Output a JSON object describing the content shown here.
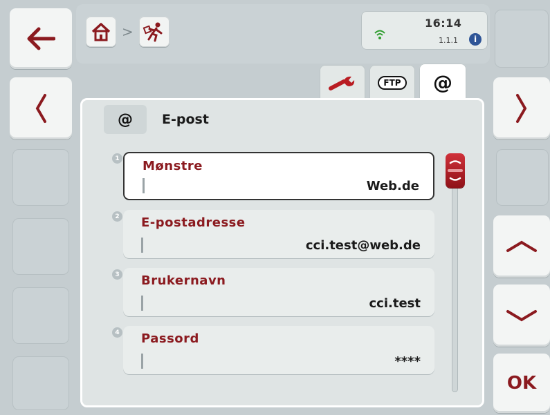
{
  "colors": {
    "accent_red": "#8b1a1f",
    "scroll_thumb": "#c0202a",
    "wifi_green": "#2e9d2e",
    "info_blue": "#2f5597"
  },
  "left_softkeys": [
    {
      "icon": "arrow-left-icon",
      "label": ""
    },
    {
      "icon": "chevron-left-icon",
      "label": ""
    },
    {
      "icon": "",
      "label": ""
    },
    {
      "icon": "",
      "label": ""
    },
    {
      "icon": "",
      "label": ""
    },
    {
      "icon": "",
      "label": ""
    }
  ],
  "right_softkeys": [
    {
      "icon": "",
      "label": ""
    },
    {
      "icon": "chevron-right-icon",
      "label": ""
    },
    {
      "icon": "",
      "label": ""
    },
    {
      "icon": "chevron-up-icon",
      "label": ""
    },
    {
      "icon": "chevron-down-icon",
      "label": ""
    },
    {
      "icon": "",
      "label": "OK"
    }
  ],
  "breadcrumb": {
    "separator": ">",
    "items": [
      {
        "icon": "home-icon"
      },
      {
        "icon": "service-person-icon"
      }
    ]
  },
  "status": {
    "time": "16:14",
    "version": "1.1.1",
    "info": "i"
  },
  "tabs": [
    {
      "icon": "wrench-icon",
      "label": ""
    },
    {
      "icon": "ftp-icon",
      "label": "FTP"
    },
    {
      "icon": "at-icon",
      "label": "@",
      "active": true
    }
  ],
  "panel": {
    "title_icon": "@",
    "title": "E-post"
  },
  "fields": [
    {
      "index": "1",
      "label": "Mønstre",
      "value": "Web.de",
      "selected": true
    },
    {
      "index": "2",
      "label": "E-postadresse",
      "value": "cci.test@web.de",
      "selected": false
    },
    {
      "index": "3",
      "label": "Brukernavn",
      "value": "cci.test",
      "selected": false
    },
    {
      "index": "4",
      "label": "Passord",
      "value": "****",
      "selected": false
    }
  ],
  "scrollbar": {
    "position": 0.0
  }
}
